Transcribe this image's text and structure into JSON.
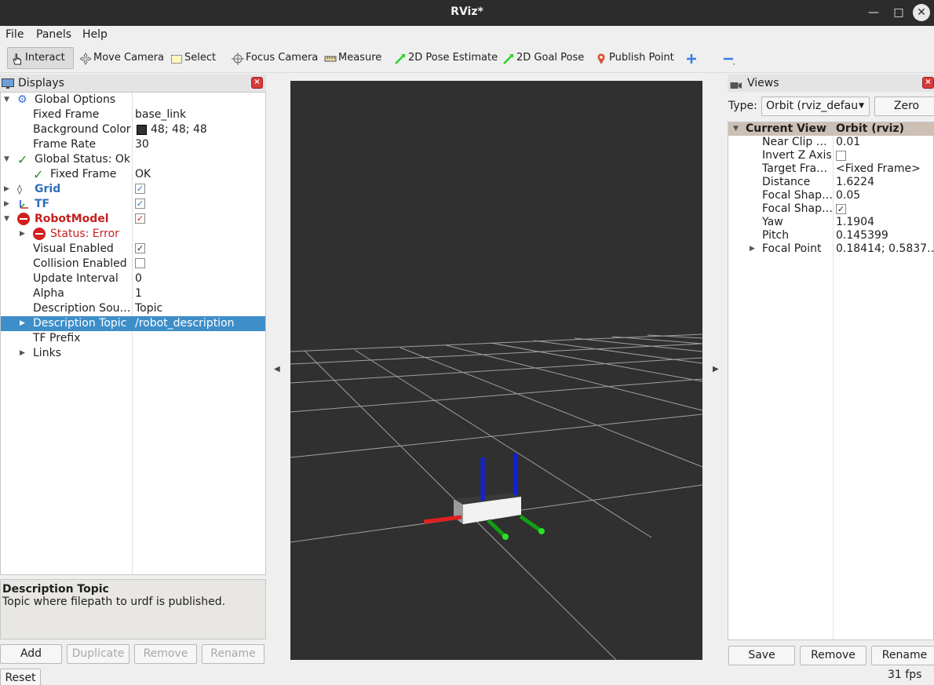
{
  "window": {
    "title": "RViz*"
  },
  "menu": {
    "file": "File",
    "panels": "Panels",
    "help": "Help"
  },
  "toolbar": {
    "interact": "Interact",
    "move_camera": "Move Camera",
    "select": "Select",
    "focus_camera": "Focus Camera",
    "measure": "Measure",
    "pose_estimate": "2D Pose Estimate",
    "goal_pose": "2D Goal Pose",
    "publish_point": "Publish Point"
  },
  "displays": {
    "title": "Displays",
    "global_options": {
      "label": "Global Options",
      "fixed_frame_label": "Fixed Frame",
      "fixed_frame_value": "base_link",
      "bg_color_label": "Background Color",
      "bg_color_value": "48; 48; 48",
      "bg_color_swatch": "#303030",
      "frame_rate_label": "Frame Rate",
      "frame_rate_value": "30"
    },
    "global_status": {
      "label": "Global Status: Ok",
      "fixed_frame_label": "Fixed Frame",
      "fixed_frame_value": "OK"
    },
    "grid": {
      "label": "Grid",
      "checked": true
    },
    "tf": {
      "label": "TF",
      "checked": true
    },
    "robot_model": {
      "label": "RobotModel",
      "checked": true,
      "status_label": "Status: Error",
      "visual_enabled_label": "Visual Enabled",
      "visual_enabled": true,
      "collision_enabled_label": "Collision Enabled",
      "collision_enabled": false,
      "update_interval_label": "Update Interval",
      "update_interval_value": "0",
      "alpha_label": "Alpha",
      "alpha_value": "1",
      "desc_source_label": "Description Sou…",
      "desc_source_value": "Topic",
      "desc_topic_label": "Description Topic",
      "desc_topic_value": "/robot_description",
      "tf_prefix_label": "TF Prefix",
      "links_label": "Links"
    },
    "description": {
      "title": "Description Topic",
      "text": "Topic where filepath to urdf is published."
    },
    "buttons": {
      "add": "Add",
      "duplicate": "Duplicate",
      "remove": "Remove",
      "rename": "Rename"
    },
    "reset": "Reset"
  },
  "views": {
    "title": "Views",
    "type_label": "Type:",
    "type_value": "Orbit (rviz_defau",
    "zero": "Zero",
    "header_label": "Current View",
    "header_value": "Orbit (rviz)",
    "props": [
      {
        "label": "Near Clip …",
        "value": "0.01"
      },
      {
        "label": "Invert Z Axis",
        "value": ""
      },
      {
        "label": "Target Fra…",
        "value": "<Fixed Frame>"
      },
      {
        "label": "Distance",
        "value": "1.6224"
      },
      {
        "label": "Focal Shap…",
        "value": "0.05"
      },
      {
        "label": "Focal Shap…",
        "value": ""
      },
      {
        "label": "Yaw",
        "value": "1.1904"
      },
      {
        "label": "Pitch",
        "value": "0.145399"
      },
      {
        "label": "Focal Point",
        "value": "0.18414; 0.5837…"
      }
    ],
    "buttons": {
      "save": "Save",
      "remove": "Remove",
      "rename": "Rename"
    }
  },
  "status": {
    "fps": "31 fps"
  },
  "colors": {
    "viewport_bg": "#303030",
    "grid": "#a0a0a0",
    "selection": "#3d8ec9",
    "error": "#c42020",
    "axis_x": "#e02020",
    "axis_y": "#10a010",
    "axis_z": "#1020e0"
  }
}
